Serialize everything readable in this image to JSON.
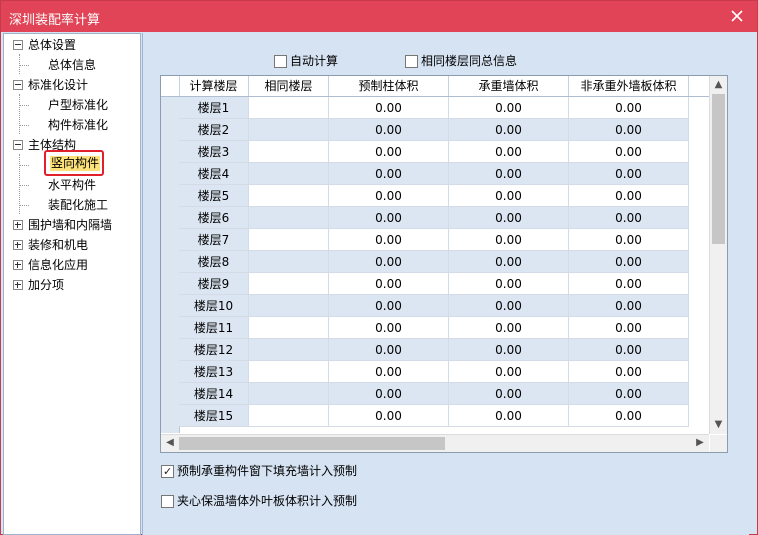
{
  "window": {
    "title": "深圳装配率计算"
  },
  "tree": {
    "groups": [
      {
        "label": "总体设置",
        "expanded": true,
        "children": [
          "总体信息"
        ]
      },
      {
        "label": "标准化设计",
        "expanded": true,
        "children": [
          "户型标准化",
          "构件标准化"
        ]
      },
      {
        "label": "主体结构",
        "expanded": true,
        "children": [
          "竖向构件",
          "水平构件",
          "装配化施工"
        ]
      },
      {
        "label": "围护墙和内隔墙",
        "expanded": false,
        "children": []
      },
      {
        "label": "装修和机电",
        "expanded": false,
        "children": []
      },
      {
        "label": "信息化应用",
        "expanded": false,
        "children": []
      },
      {
        "label": "加分项",
        "expanded": false,
        "children": []
      }
    ],
    "selected": "竖向构件"
  },
  "options": {
    "auto_calc": {
      "label": "自动计算",
      "checked": false
    },
    "same_floor_summary": {
      "label": "相同楼层同总信息",
      "checked": false
    },
    "prefab_fill_wall": {
      "label": "预制承重构件窗下填充墙计入预制",
      "checked": true
    },
    "sandwich_insulation": {
      "label": "夹心保温墙体外叶板体积计入预制",
      "checked": false
    }
  },
  "table": {
    "columns": [
      "计算楼层",
      "相同楼层",
      "预制柱体积",
      "承重墙体积",
      "非承重外墙板体积"
    ],
    "rows": [
      {
        "floor": "楼层1",
        "same": "",
        "col": "0.00",
        "wall": "0.00",
        "ext": "0.00"
      },
      {
        "floor": "楼层2",
        "same": "",
        "col": "0.00",
        "wall": "0.00",
        "ext": "0.00"
      },
      {
        "floor": "楼层3",
        "same": "",
        "col": "0.00",
        "wall": "0.00",
        "ext": "0.00"
      },
      {
        "floor": "楼层4",
        "same": "",
        "col": "0.00",
        "wall": "0.00",
        "ext": "0.00"
      },
      {
        "floor": "楼层5",
        "same": "",
        "col": "0.00",
        "wall": "0.00",
        "ext": "0.00"
      },
      {
        "floor": "楼层6",
        "same": "",
        "col": "0.00",
        "wall": "0.00",
        "ext": "0.00"
      },
      {
        "floor": "楼层7",
        "same": "",
        "col": "0.00",
        "wall": "0.00",
        "ext": "0.00"
      },
      {
        "floor": "楼层8",
        "same": "",
        "col": "0.00",
        "wall": "0.00",
        "ext": "0.00"
      },
      {
        "floor": "楼层9",
        "same": "",
        "col": "0.00",
        "wall": "0.00",
        "ext": "0.00"
      },
      {
        "floor": "楼层10",
        "same": "",
        "col": "0.00",
        "wall": "0.00",
        "ext": "0.00"
      },
      {
        "floor": "楼层11",
        "same": "",
        "col": "0.00",
        "wall": "0.00",
        "ext": "0.00"
      },
      {
        "floor": "楼层12",
        "same": "",
        "col": "0.00",
        "wall": "0.00",
        "ext": "0.00"
      },
      {
        "floor": "楼层13",
        "same": "",
        "col": "0.00",
        "wall": "0.00",
        "ext": "0.00"
      },
      {
        "floor": "楼层14",
        "same": "",
        "col": "0.00",
        "wall": "0.00",
        "ext": "0.00"
      },
      {
        "floor": "楼层15",
        "same": "",
        "col": "0.00",
        "wall": "0.00",
        "ext": "0.00"
      }
    ]
  },
  "colors": {
    "titlebar": "#e04456",
    "panel": "#d6e3f3",
    "row_alt": "#dce6f2",
    "highlight": "#e0202b"
  }
}
